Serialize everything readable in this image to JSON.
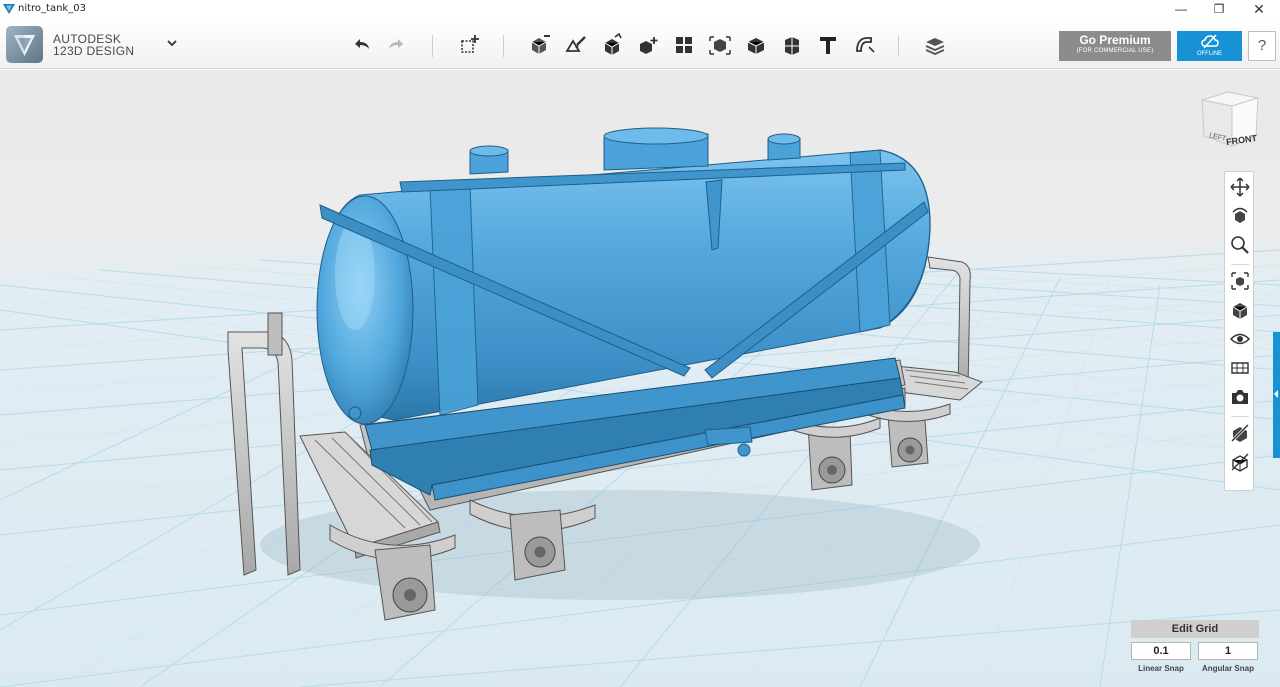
{
  "window": {
    "title": "nitro_tank_03",
    "minimize": "—",
    "maximize": "❐",
    "close": "✕"
  },
  "brand": {
    "company": "AUTODESK",
    "product": "123D DESIGN"
  },
  "toolbar": {
    "icons": [
      "undo-icon",
      "redo-icon",
      "primitives-icon",
      "sketch-icon",
      "construct-icon",
      "modify-icon",
      "pattern-icon",
      "grouping-icon",
      "combine-icon",
      "measure-icon",
      "snap-icon",
      "text-icon",
      "material-icon",
      "layers-icon"
    ]
  },
  "premium": {
    "label": "Go Premium",
    "sublabel": "(FOR COMMERCIAL USE)"
  },
  "offline": {
    "label": "OFFLINE"
  },
  "help": {
    "label": "?"
  },
  "viewcube": {
    "front": "FRONT",
    "left": "LEFT"
  },
  "navbar": {
    "icons": [
      "pan-icon",
      "orbit-icon",
      "zoom-icon",
      "fit-icon",
      "view-icon",
      "visibility-icon",
      "material-visibility-icon",
      "screenshot-icon",
      "hide-solid-icon",
      "hide-mesh-icon"
    ]
  },
  "grid": {
    "edit_label": "Edit Grid",
    "linear_snap_value": "0.1",
    "linear_snap_label": "Linear Snap",
    "angular_snap_value": "1",
    "angular_snap_label": "Angular Snap"
  },
  "colors": {
    "tank_blue": "#4fa6dc",
    "frame_grey": "#c9c9c9",
    "grid_line": "#b7dbea",
    "accent": "#1792d4"
  }
}
